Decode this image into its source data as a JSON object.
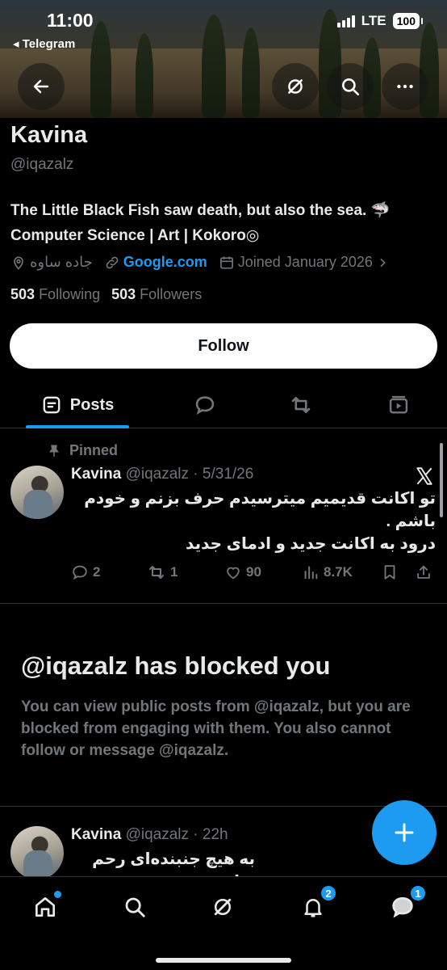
{
  "status_bar": {
    "time": "11:00",
    "back_app": "◂ Telegram",
    "network": "LTE",
    "battery": "100"
  },
  "profile": {
    "name": "Kavina",
    "handle": "@iqazalz",
    "bio_line1": "The Little Black Fish saw death, but also the sea. 🦈",
    "bio_line2": "Computer Science | Art | Kokoro◎",
    "location": "جاده ساوه",
    "website": "Google.com",
    "joined": "Joined January 2026",
    "following_count": "503",
    "following_label": "Following",
    "followers_count": "503",
    "followers_label": "Followers",
    "follow_label": "Follow"
  },
  "tabs": {
    "active_label": "Posts",
    "icons": [
      "posts-icon",
      "reply-icon",
      "repost-icon",
      "media-icon"
    ]
  },
  "pinned_post": {
    "pinned_label": "Pinned",
    "author": "Kavina",
    "handle_time": "@iqazalz · 5/31/26",
    "line1": "تو اکانت قدیمیم میترسیدم حرف بزنم و خودم",
    "line2": "باشم .",
    "line3": "درود به اکانت جدید و ادمای جدید",
    "replies": "2",
    "reposts": "1",
    "likes": "90",
    "views": "8.7K"
  },
  "blocked": {
    "title": "@iqazalz has blocked you",
    "text": "You can view public posts from @iqazalz, but you are blocked from engaging with them. You also cannot follow or message @iqazalz."
  },
  "second_post": {
    "author": "Kavina",
    "handle_time": "@iqazalz · 22h",
    "line1": "به هیچ جنبنده‌ای رحم ندارن ."
  },
  "bottom_nav": {
    "notifications_badge": "2",
    "messages_badge": "1"
  },
  "colors": {
    "accent": "#1d9bf0",
    "muted": "#71767b",
    "text": "#e7e9ea"
  }
}
